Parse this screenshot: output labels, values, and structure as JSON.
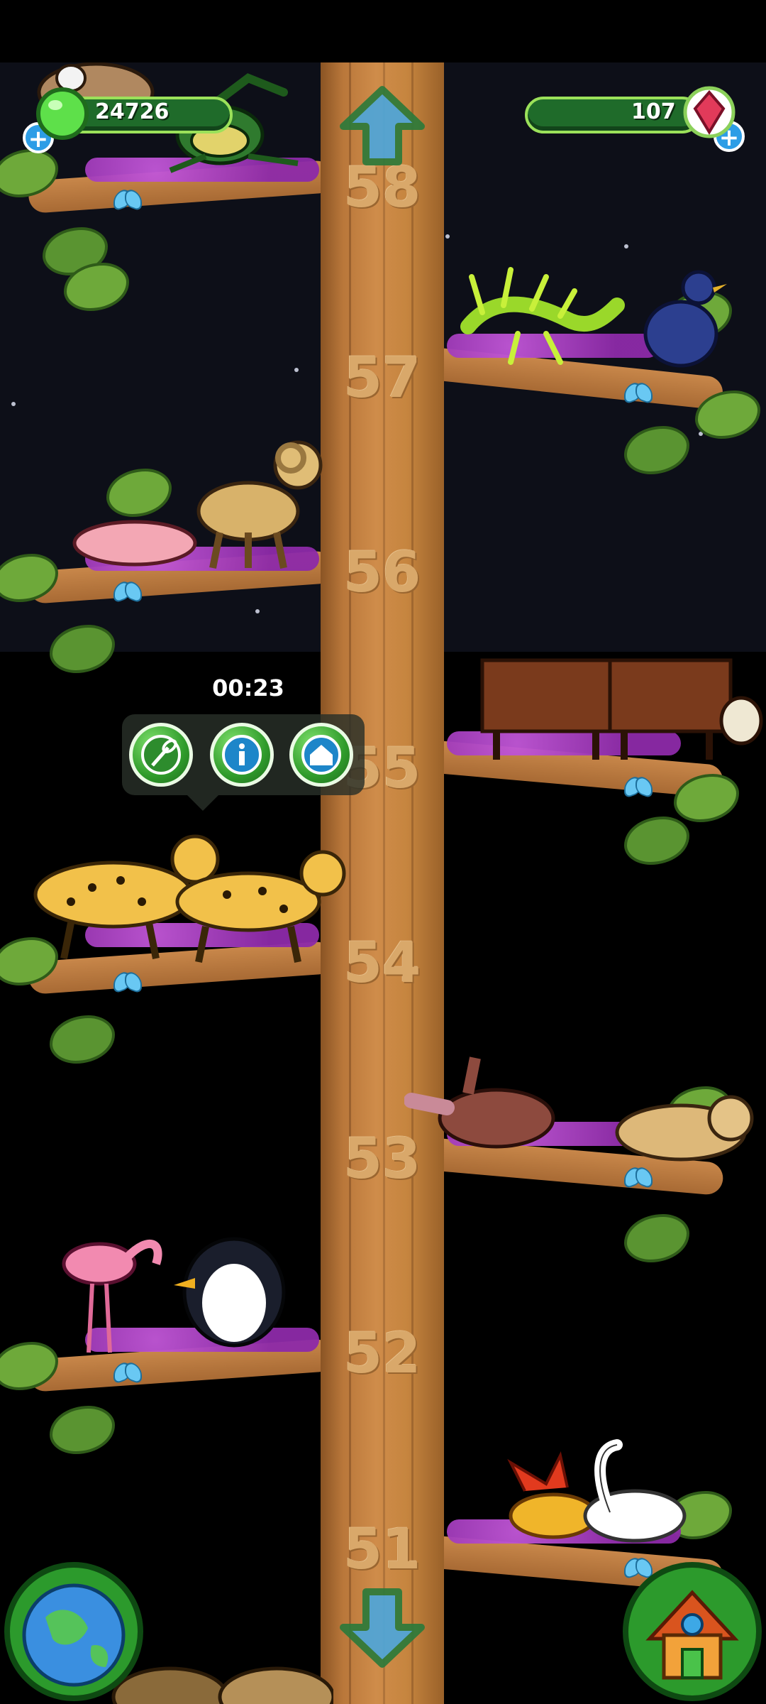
{
  "hud": {
    "green_currency": "24726",
    "gem_currency": "107",
    "add_green_label": "+",
    "add_gem_label": "+"
  },
  "popup": {
    "timer": "00:23",
    "buttons": [
      "net-icon",
      "info-icon",
      "habitat-icon"
    ]
  },
  "levels": [
    "58",
    "57",
    "56",
    "55",
    "54",
    "53",
    "52",
    "51"
  ],
  "animals": {
    "level_58": [
      "dog",
      "mantis"
    ],
    "level_57": [
      "leafy-sea-dragon",
      "blue-bird"
    ],
    "level_56": [
      "naked-mole-rat",
      "bighorn-camel"
    ],
    "level_55": [
      "brown-cow",
      "brown-cow"
    ],
    "level_54": [
      "cheetah",
      "cheetah"
    ],
    "level_53": [
      "aardvark",
      "lynx"
    ],
    "level_52": [
      "flamingo",
      "penguin"
    ],
    "level_51": [
      "fire-bird",
      "swan"
    ]
  },
  "colors": {
    "sky": "#0d0f18",
    "trunk": "#c6853f",
    "leaf": "#6ea93a",
    "moss": "#a93fc7",
    "hud_green": "#1f6b2a",
    "button_blue": "#2d9de6"
  }
}
